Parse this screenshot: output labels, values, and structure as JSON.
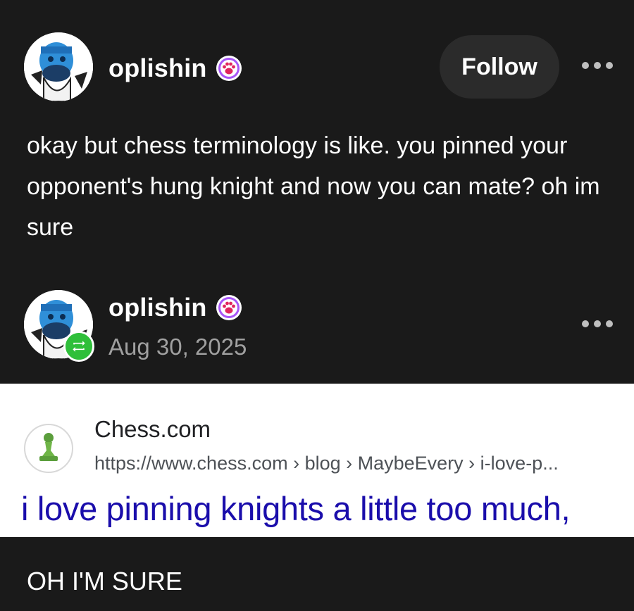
{
  "post": {
    "author": "oplishin",
    "follow_label": "Follow",
    "text": "okay but chess terminology is like. you pinned your opponent's hung knight and now you can mate? oh im sure"
  },
  "reblog": {
    "author": "oplishin",
    "date": "Aug 30, 2025"
  },
  "search_result": {
    "site_name": "Chess.com",
    "url": "https://www.chess.com › blog › MaybeEvery › i-love-p...",
    "title": "i love pinning knights a little too much,"
  },
  "caption": "OH I'M SURE",
  "colors": {
    "background": "#1a1a1a",
    "follow_button": "#2b2b2b",
    "link_title": "#1a0dab",
    "reblog_green": "#2fbf3a",
    "badge_purple": "#a855f7"
  }
}
